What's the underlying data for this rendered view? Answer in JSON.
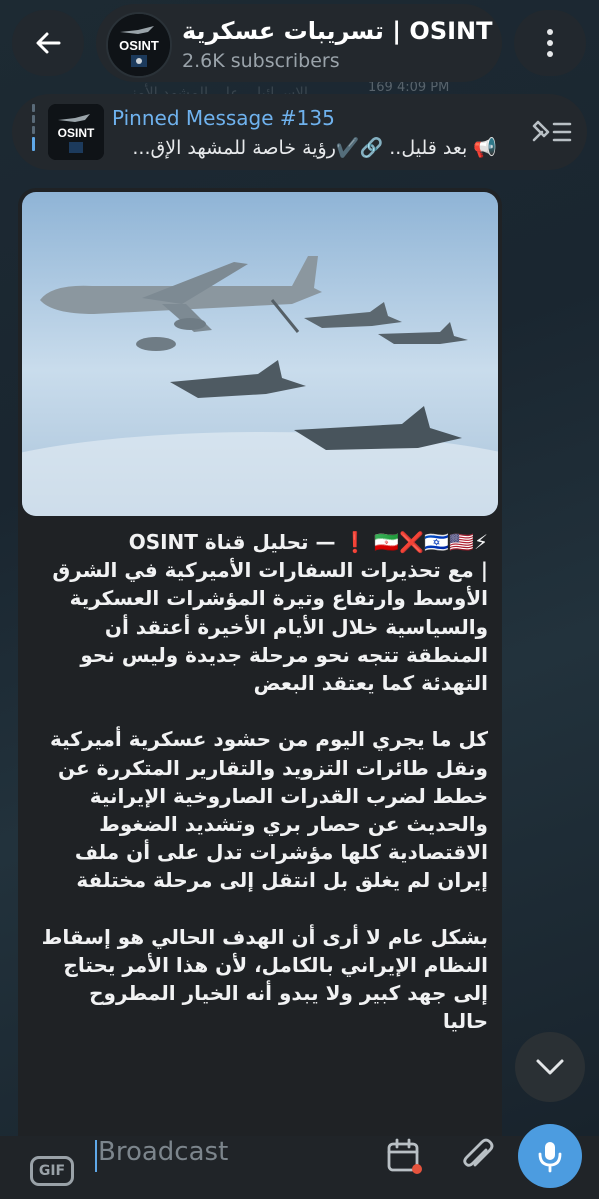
{
  "header": {
    "back_icon": "arrow-left-icon",
    "title": "تسريبات عسكرية | OSINT",
    "subtitle": "2.6K subscribers",
    "avatar_text": "OSINT",
    "menu_icon": "vertical-dots-icon"
  },
  "background": {
    "ghost_text": "الإسرائيلي على المشهد الأمني",
    "meta": "169  4:09 PM"
  },
  "pinned": {
    "title": "Pinned Message #135",
    "text": "📢 بعد قليل.. 🔗✔️رؤية خاصة للمشهد الإق...",
    "avatar_text": "OSINT"
  },
  "message": {
    "header_line": "⚡🇮🇷❌🇮🇱🇺🇸 ❗ — تحليل قناة OSINT",
    "paragraph_1": "| مع تحذيرات السفارات الأميركية في الشرق الأوسط وارتفاع وتيرة المؤشرات العسكرية والسياسية خلال الأيام الأخيرة أعتقد أن المنطقة تتجه نحو مرحلة جديدة وليس نحو التهدئة كما يعتقد البعض",
    "paragraph_2": "كل ما يجري اليوم من حشود عسكرية أميركية ونقل طائرات التزويد والتقارير المتكررة عن خطط لضرب القدرات الصاروخية الإيرانية والحديث عن حصار بري وتشديد الضغوط الاقتصادية كلها مؤشرات تدل على أن ملف إيران لم يغلق بل انتقل إلى مرحلة مختلفة",
    "paragraph_3": "بشكل عام لا أرى أن الهدف الحالي هو إسقاط النظام الإيراني بالكامل، لأن هذا الأمر يحتاج إلى جهد كبير ولا يبدو أنه الخيار المطروح حاليا"
  },
  "composer": {
    "gif_label": "GIF",
    "placeholder": "Broadcast",
    "calendar_icon": "calendar-icon",
    "attach_icon": "paperclip-icon",
    "mic_icon": "microphone-icon"
  },
  "colors": {
    "accent": "#4c9ce0",
    "pinned_title": "#6fb2ee",
    "bubble": "#1f2225"
  }
}
